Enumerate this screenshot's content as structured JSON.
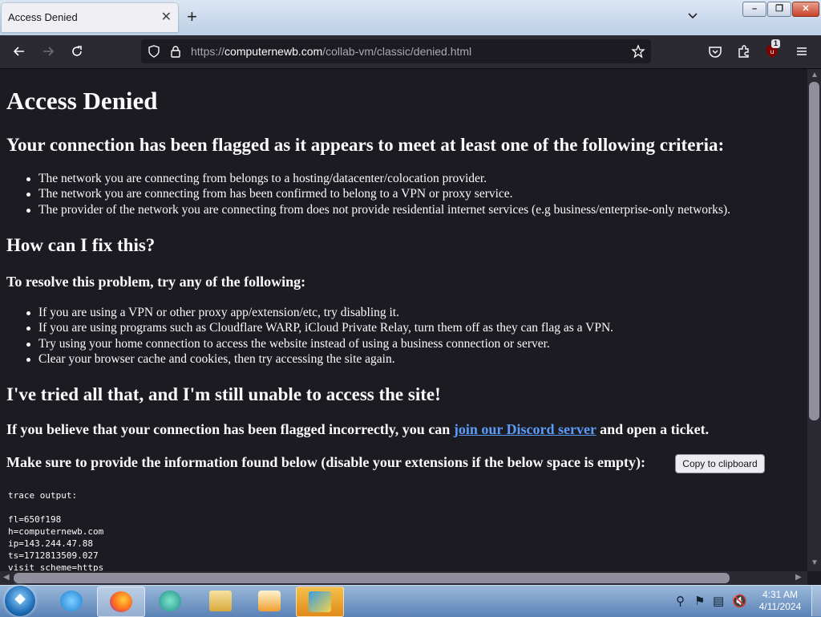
{
  "browser": {
    "tab_title": "Access Denied",
    "tab_close": "✕",
    "new_tab": "+",
    "url_prefix": "https://",
    "url_host": "computernewb.com",
    "url_path": "/collab-vm/classic/denied.html",
    "extension_badge": "1"
  },
  "page": {
    "title": "Access Denied",
    "flagged_heading": "Your connection has been flagged as it appears to meet at least one of the following criteria:",
    "criteria": [
      "The network you are connecting from belongs to a hosting/datacenter/colocation provider.",
      "The network you are connecting from has been confirmed to belong to a VPN or proxy service.",
      "The provider of the network you are connecting from does not provide residential internet services (e.g business/enterprise-only networks)."
    ],
    "fix_heading": "How can I fix this?",
    "resolve_heading": "To resolve this problem, try any of the following:",
    "fixes": [
      "If you are using a VPN or other proxy app/extension/etc, try disabling it.",
      "If you are using programs such as Cloudflare WARP, iCloud Private Relay, turn them off as they can flag as a VPN.",
      "Try using your home connection to access the website instead of using a business connection or server.",
      "Clear your browser cache and cookies, then try accessing the site again."
    ],
    "still_heading": "I've tried all that, and I'm still unable to access the site!",
    "discord_before": "If you believe that your connection has been flagged incorrectly, you can ",
    "discord_link": "join our Discord server",
    "discord_after": " and open a ticket.",
    "provide_info": "Make sure to provide the information found below (disable your extensions if the below space is empty):",
    "copy_button": "Copy to clipboard",
    "trace_lines": [
      "trace output:",
      "",
      "fl=650f198",
      "h=computernewb.com",
      "ip=143.244.47.88",
      "ts=1712813509.027",
      "visit_scheme=https"
    ]
  },
  "taskbar": {
    "time": "4:31 AM",
    "date": "4/11/2024"
  }
}
